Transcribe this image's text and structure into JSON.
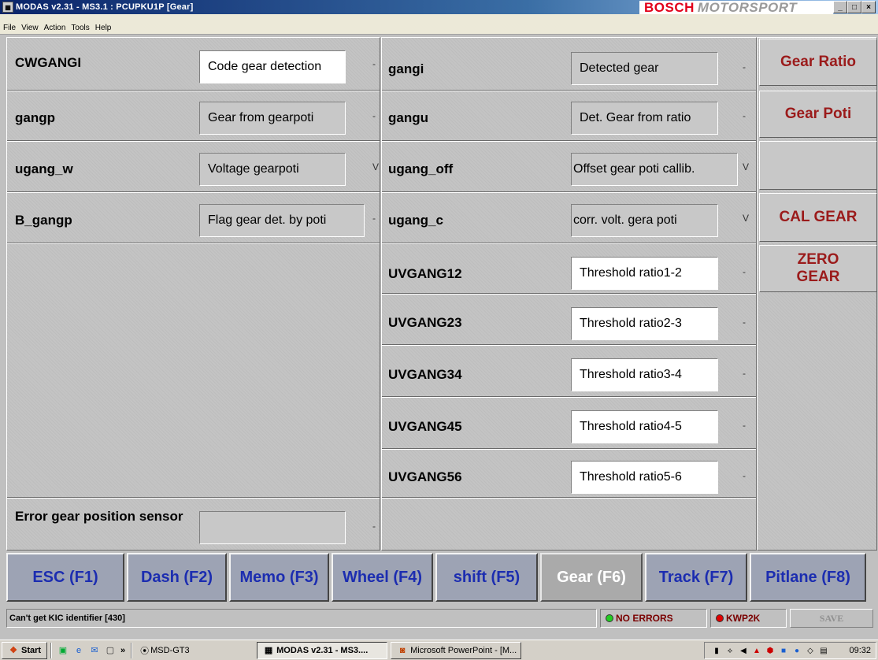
{
  "window": {
    "title": "MODAS v2.31 - MS3.1 : PCUPKU1P   [Gear]",
    "brand_main": "BOSCH",
    "brand_sub": "MOTORSPORT",
    "min": "_",
    "max": "□",
    "close": "×"
  },
  "menu": [
    "File",
    "View",
    "Action",
    "Tools",
    "Help"
  ],
  "left_rows": [
    {
      "name": "CWGANGI",
      "desc": "Code gear detection",
      "unit": "-"
    },
    {
      "name": "gangp",
      "desc": "Gear from gearpoti",
      "unit": "-"
    },
    {
      "name": "ugang_w",
      "desc": "Voltage gearpoti",
      "unit": "V"
    },
    {
      "name": "B_gangp",
      "desc": "Flag gear det. by poti",
      "unit": "-"
    }
  ],
  "error_row": {
    "label": "Error gear position sensor",
    "value": "",
    "unit": "-"
  },
  "mid_rows": [
    {
      "name": "gangi",
      "desc": "Detected gear",
      "unit": "-"
    },
    {
      "name": "gangu",
      "desc": "Det. Gear from ratio",
      "unit": "-"
    },
    {
      "name": "ugang_off",
      "desc": "Offset gear poti callib.",
      "unit": "V"
    },
    {
      "name": "ugang_c",
      "desc": "corr. volt. gera poti",
      "unit": "V"
    }
  ],
  "thresholds": [
    {
      "name": "UVGANG12",
      "desc": "Threshold ratio1-2",
      "unit": "-"
    },
    {
      "name": "UVGANG23",
      "desc": "Threshold ratio2-3",
      "unit": "-"
    },
    {
      "name": "UVGANG34",
      "desc": "Threshold ratio3-4",
      "unit": "-"
    },
    {
      "name": "UVGANG45",
      "desc": "Threshold ratio4-5",
      "unit": "-"
    },
    {
      "name": "UVGANG56",
      "desc": "Threshold ratio5-6",
      "unit": "-"
    }
  ],
  "right_buttons": {
    "gear_ratio": "Gear Ratio",
    "gear_poti": "Gear Poti",
    "cal_gear": "CAL GEAR",
    "zero_gear_1": "ZERO",
    "zero_gear_2": "GEAR"
  },
  "fkeys": [
    "ESC (F1)",
    "Dash (F2)",
    "Memo (F3)",
    "Wheel  (F4)",
    "shift  (F5)",
    "Gear  (F6)",
    "Track  (F7)",
    "Pitlane (F8)"
  ],
  "status": {
    "message": "Can't get KIC identifier [430]",
    "no_errors": "NO ERRORS",
    "kwp": "KWP2K",
    "save": "SAVE",
    "colors": {
      "ok": "#22cc22",
      "err": "#e00000"
    }
  },
  "taskbar": {
    "start": "Start",
    "chevron": "»",
    "msd": "MSD-GT3",
    "modas": "MODAS v2.31 - MS3....",
    "ppt": "Microsoft PowerPoint - [M...",
    "clock": "09:32"
  }
}
